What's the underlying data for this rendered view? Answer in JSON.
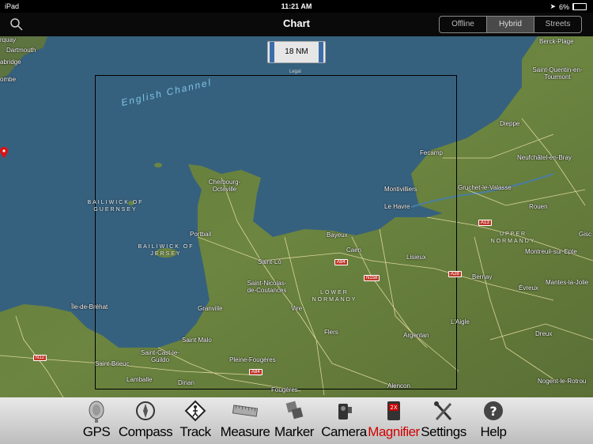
{
  "status": {
    "device": "iPad",
    "time": "11:21 AM",
    "battery": "6%"
  },
  "nav": {
    "title": "Chart",
    "segments": [
      "Offline",
      "Hybrid",
      "Streets"
    ],
    "active_segment": "Hybrid"
  },
  "map": {
    "scale_label": "18 NM",
    "legal": "Legal",
    "sea_label": "English Channel",
    "places": [
      "rquay",
      "Dartmouth",
      "abridge",
      "ombe",
      "Berck-Plage",
      "Saint-Quentin-en-Tourmont",
      "Dieppe",
      "Fecamp",
      "Neufchâtel-en-Bray",
      "Gruchet-le-Valasse",
      "Montivilliers",
      "Le Havre",
      "Rouen",
      "Cherbourg-Octeville",
      "Portbail",
      "Bayeux",
      "Caen",
      "Saint-Lô",
      "Lisieux",
      "Saint-Nicolas-de-Coutances",
      "Bernay",
      "Évreux",
      "Montreuil-sur-Epte",
      "Mantes-la-Jolie",
      "Vire",
      "Granville",
      "L'Aigle",
      "Flers",
      "Argentan",
      "Dreux",
      "Saint Malo",
      "Saint-Cast-le-Guildo",
      "Saint-Brieuc",
      "Pleine-Fougères",
      "Lamballe",
      "Dinan",
      "Fougères",
      "Alencon",
      "Île-de-Bréhat",
      "Gisc",
      "Nogent-le-Rotrou"
    ],
    "regions": {
      "guernsey": "BAILIWICK OF GUERNSEY",
      "jersey": "BAILIWICK OF JERSEY",
      "upper": "UPPER NORMANDY",
      "lower": "LOWER NORMANDY"
    },
    "road_shields": [
      "A84",
      "N158",
      "A13",
      "A13",
      "A28",
      "N12",
      "A84"
    ]
  },
  "toolbar": {
    "items": [
      {
        "label": "GPS",
        "icon": "gps-satellite-dish-icon"
      },
      {
        "label": "Compass",
        "icon": "compass-icon"
      },
      {
        "label": "Track",
        "icon": "track-walker-icon"
      },
      {
        "label": "Measure",
        "icon": "ruler-icon"
      },
      {
        "label": "Marker",
        "icon": "marker-icon"
      },
      {
        "label": "Camera",
        "icon": "camera-icon"
      },
      {
        "label": "Magnifier",
        "icon": "magnifier-2x-icon"
      },
      {
        "label": "Settings",
        "icon": "settings-tools-icon"
      },
      {
        "label": "Help",
        "icon": "help-icon"
      }
    ],
    "active_color": "#d00000"
  }
}
